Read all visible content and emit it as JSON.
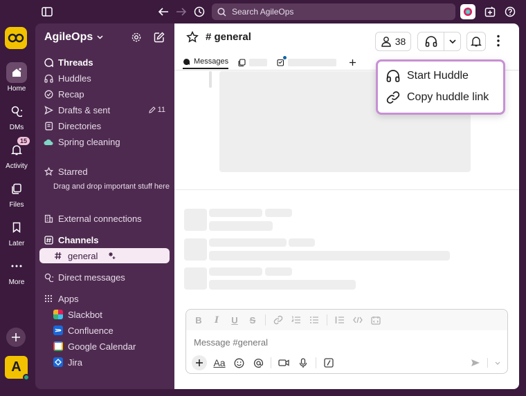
{
  "topbar": {
    "search_placeholder": "Search AgileOps"
  },
  "rail": {
    "items": [
      {
        "label": "Home"
      },
      {
        "label": "DMs"
      },
      {
        "label": "Activity",
        "badge": "15"
      },
      {
        "label": "Files"
      },
      {
        "label": "Later"
      },
      {
        "label": "More"
      }
    ],
    "user_initial": "A"
  },
  "sidebar": {
    "workspace": "AgileOps",
    "items": [
      {
        "label": "Threads"
      },
      {
        "label": "Huddles"
      },
      {
        "label": "Recap"
      },
      {
        "label": "Drafts & sent",
        "count": "11"
      },
      {
        "label": "Directories"
      },
      {
        "label": "Spring cleaning"
      }
    ],
    "starred": {
      "label": "Starred",
      "hint": "Drag and drop important stuff here"
    },
    "external": "External connections",
    "channels": {
      "label": "Channels",
      "items": [
        {
          "label": "general"
        }
      ]
    },
    "direct_messages": "Direct messages",
    "apps": {
      "label": "Apps",
      "items": [
        {
          "label": "Slackbot"
        },
        {
          "label": "Confluence"
        },
        {
          "label": "Google Calendar"
        },
        {
          "label": "Jira"
        }
      ]
    }
  },
  "channel": {
    "name": "# general",
    "members_count": "38",
    "tabs": [
      {
        "label": "Messages"
      }
    ]
  },
  "composer": {
    "placeholder": "Message #general"
  },
  "huddle_menu": {
    "items": [
      {
        "label": "Start Huddle"
      },
      {
        "label": "Copy huddle link"
      }
    ]
  },
  "colors": {
    "aubergine": "#3b1a3e",
    "sidebar": "#4e2a50",
    "menu_border": "#c890d4"
  }
}
